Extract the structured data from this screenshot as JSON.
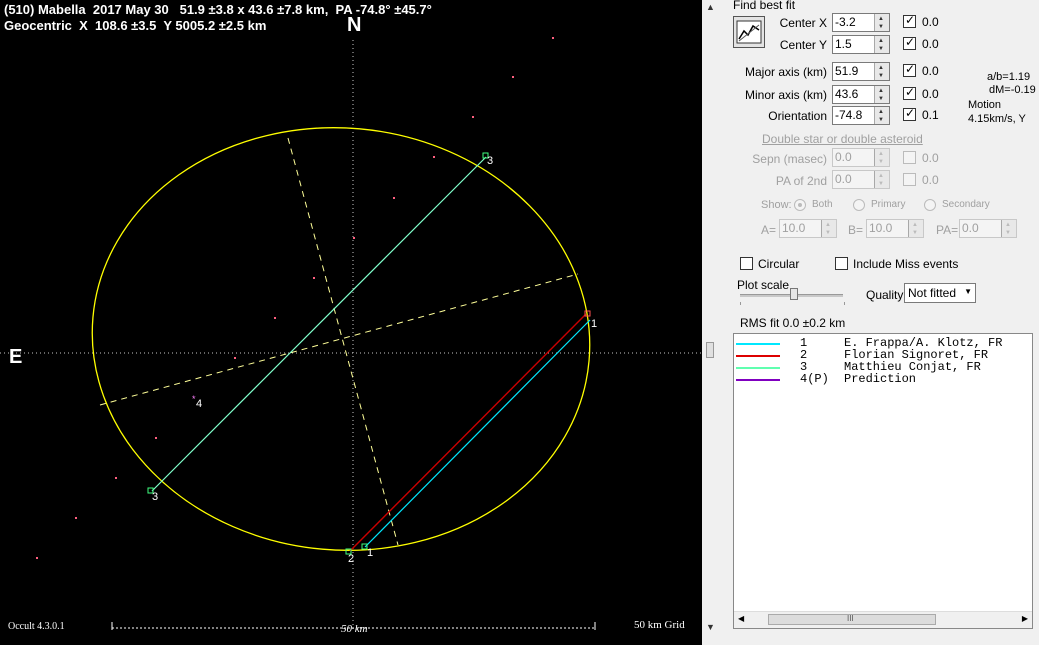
{
  "plot": {
    "title_line1": "(510) Mabella  2017 May 30   51.9 ±3.8 x 43.6 ±7.8 km,  PA -74.8° ±45.7°",
    "title_line2": "Geocentric  X  108.6 ±3.5  Y 5005.2 ±2.5 km",
    "north_label": "N",
    "east_label": "E",
    "version": "Occult 4.3.0.1",
    "scale_label": "50 km",
    "grid_label": "50 km Grid",
    "chord_labels": [
      "3",
      "3",
      "1",
      "1",
      "2",
      "4"
    ],
    "colors": {
      "ellipse": "#ffff00",
      "chord1": "#00ffff",
      "chord2": "#cc0000",
      "chord3": "#80ffcc",
      "axis": "#ffffff",
      "dots": "#ff6080"
    }
  },
  "panel": {
    "find_best_fit": "Find best fit",
    "params": [
      {
        "label": "Center X",
        "value": "-3.2",
        "checked": true,
        "unc": "0.0"
      },
      {
        "label": "Center Y",
        "value": "1.5",
        "checked": true,
        "unc": "0.0"
      },
      {
        "label": "Major axis (km)",
        "value": "51.9",
        "checked": true,
        "unc": "0.0"
      },
      {
        "label": "Minor axis (km)",
        "value": "43.6",
        "checked": true,
        "unc": "0.0"
      },
      {
        "label": "Orientation",
        "value": "-74.8",
        "checked": true,
        "unc": "0.1"
      }
    ],
    "ratio": "a/b=1.19",
    "dm": "dM=-0.19",
    "motion_label": "Motion",
    "motion_value": "4.15km/s, Y",
    "double_header": "Double star  or  double asteroid",
    "sepn_label": "Sepn (masec)",
    "sepn_value": "0.0",
    "sepn_unc": "0.0",
    "pa2_label": "PA of 2nd",
    "pa2_value": "0.0",
    "pa2_unc": "0.0",
    "show_label": "Show:",
    "show_options": [
      "Both",
      "Primary",
      "Secondary"
    ],
    "a_label": "A=",
    "a_value": "10.0",
    "b_label": "B=",
    "b_value": "10.0",
    "pa_label": "PA=",
    "pa_value": "0.0",
    "circular_label": "Circular",
    "miss_label": "Include Miss events",
    "plot_scale_label": "Plot scale",
    "quality_label": "Quality",
    "quality_value": "Not fitted",
    "rms_label": "RMS fit  0.0 ±0.2 km",
    "legend": [
      {
        "num": "1",
        "name": "E. Frappa/A. Klotz, FR",
        "color": "#00e8ff"
      },
      {
        "num": "2",
        "name": "Florian Signoret, FR",
        "color": "#dd0000"
      },
      {
        "num": "3",
        "name": "Matthieu Conjat, FR",
        "color": "#60ffb0"
      },
      {
        "num": "4(P)",
        "name": "Prediction",
        "color": "#8000c0"
      }
    ],
    "hscroll_grip": "III"
  }
}
